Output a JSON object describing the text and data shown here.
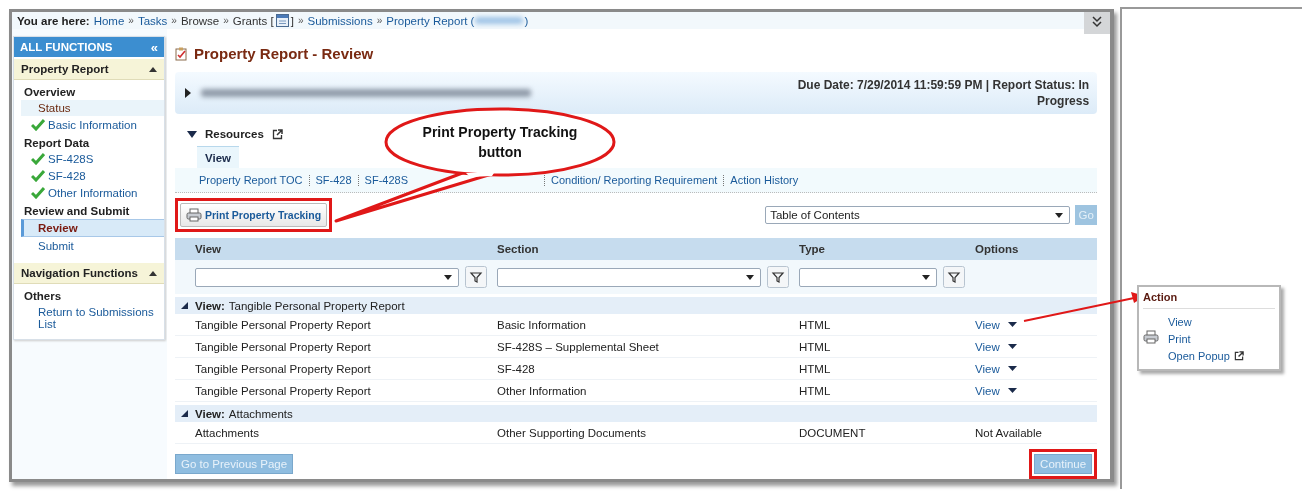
{
  "breadcrumb": {
    "label": "You are here:",
    "separator": "»",
    "items": [
      {
        "kind": "link",
        "text": "Home"
      },
      {
        "kind": "link",
        "text": "Tasks"
      },
      {
        "kind": "plain",
        "text": "Browse"
      },
      {
        "kind": "calendar",
        "before": "Grants [",
        "after": "]"
      },
      {
        "kind": "link",
        "text": "Submissions"
      },
      {
        "kind": "redacted",
        "before": "Property Report (",
        "after": ")"
      }
    ]
  },
  "sidebar": {
    "title": "ALL FUNCTIONS",
    "collapse": "«",
    "sections": [
      {
        "title": "Property Report",
        "expanded": true,
        "groups": [
          {
            "title": "Overview",
            "items": [
              {
                "text": "Status",
                "kind": "text",
                "checked": false,
                "selected": false
              },
              {
                "text": "Basic Information",
                "kind": "link",
                "checked": true,
                "selected": false
              }
            ]
          },
          {
            "title": "Report Data",
            "items": [
              {
                "text": "SF-428S",
                "kind": "link",
                "checked": true,
                "selected": false
              },
              {
                "text": "SF-428",
                "kind": "link",
                "checked": true,
                "selected": false
              },
              {
                "text": "Other Information",
                "kind": "link",
                "checked": true,
                "selected": false
              }
            ]
          },
          {
            "title": "Review and Submit",
            "items": [
              {
                "text": "Review",
                "kind": "link",
                "checked": false,
                "selected": true
              },
              {
                "text": "Submit",
                "kind": "link",
                "checked": false,
                "selected": false
              }
            ]
          }
        ]
      },
      {
        "title": "Navigation Functions",
        "expanded": true,
        "groups": [
          {
            "title": "Others",
            "items": [
              {
                "text": "Return to Submissions List",
                "kind": "link",
                "checked": false,
                "selected": false
              }
            ]
          }
        ]
      }
    ]
  },
  "page": {
    "title": "Property Report - Review",
    "summary": {
      "expanded": false,
      "due": "Due Date: 7/29/2014 11:59:59 PM | Report Status: In Progress"
    },
    "resources": {
      "title": "Resources",
      "expanded": true,
      "tabs": [
        {
          "label": "View",
          "selected": true
        }
      ],
      "links": [
        "Property Report TOC",
        "SF-428",
        "SF-428S",
        "Condition/ Reporting Requirement",
        "Action History"
      ]
    },
    "print_button": "Print Property Tracking",
    "jump": {
      "value": "Table of Contents",
      "go": "Go"
    },
    "table": {
      "columns": [
        {
          "label": "View",
          "filter": true
        },
        {
          "label": "Section",
          "filter": true
        },
        {
          "label": "Type",
          "filter": true
        },
        {
          "label": "Options",
          "filter": false
        }
      ],
      "groups": [
        {
          "label": "View:",
          "name": "Tangible Personal Property Report",
          "expanded": true,
          "rows": [
            {
              "view": "Tangible Personal Property Report",
              "section": "Basic Information",
              "type": "HTML",
              "options": {
                "text": "View",
                "kind": "menu"
              }
            },
            {
              "view": "Tangible Personal Property Report",
              "section": "SF-428S – Supplemental Sheet",
              "type": "HTML",
              "options": {
                "text": "View",
                "kind": "menu"
              }
            },
            {
              "view": "Tangible Personal Property Report",
              "section": "SF-428",
              "type": "HTML",
              "options": {
                "text": "View",
                "kind": "menu"
              }
            },
            {
              "view": "Tangible Personal Property Report",
              "section": "Other Information",
              "type": "HTML",
              "options": {
                "text": "View",
                "kind": "menu"
              }
            }
          ]
        },
        {
          "label": "View:",
          "name": "Attachments",
          "expanded": true,
          "rows": [
            {
              "view": "Attachments",
              "section": "Other Supporting Documents",
              "type": "DOCUMENT",
              "options": {
                "text": "Not Available",
                "kind": "text"
              }
            }
          ]
        }
      ]
    },
    "buttons": [
      {
        "label": "Go to Previous Page",
        "disabled": true
      },
      {
        "label": "Continue",
        "disabled": true
      }
    ]
  },
  "callout": {
    "text": "Print Property Tracking button"
  },
  "action_menu": {
    "title": "Action",
    "items": [
      {
        "text": "View",
        "kind": "plain"
      },
      {
        "text": "Print",
        "kind": "print"
      },
      {
        "text": "Open Popup",
        "kind": "external"
      }
    ]
  }
}
